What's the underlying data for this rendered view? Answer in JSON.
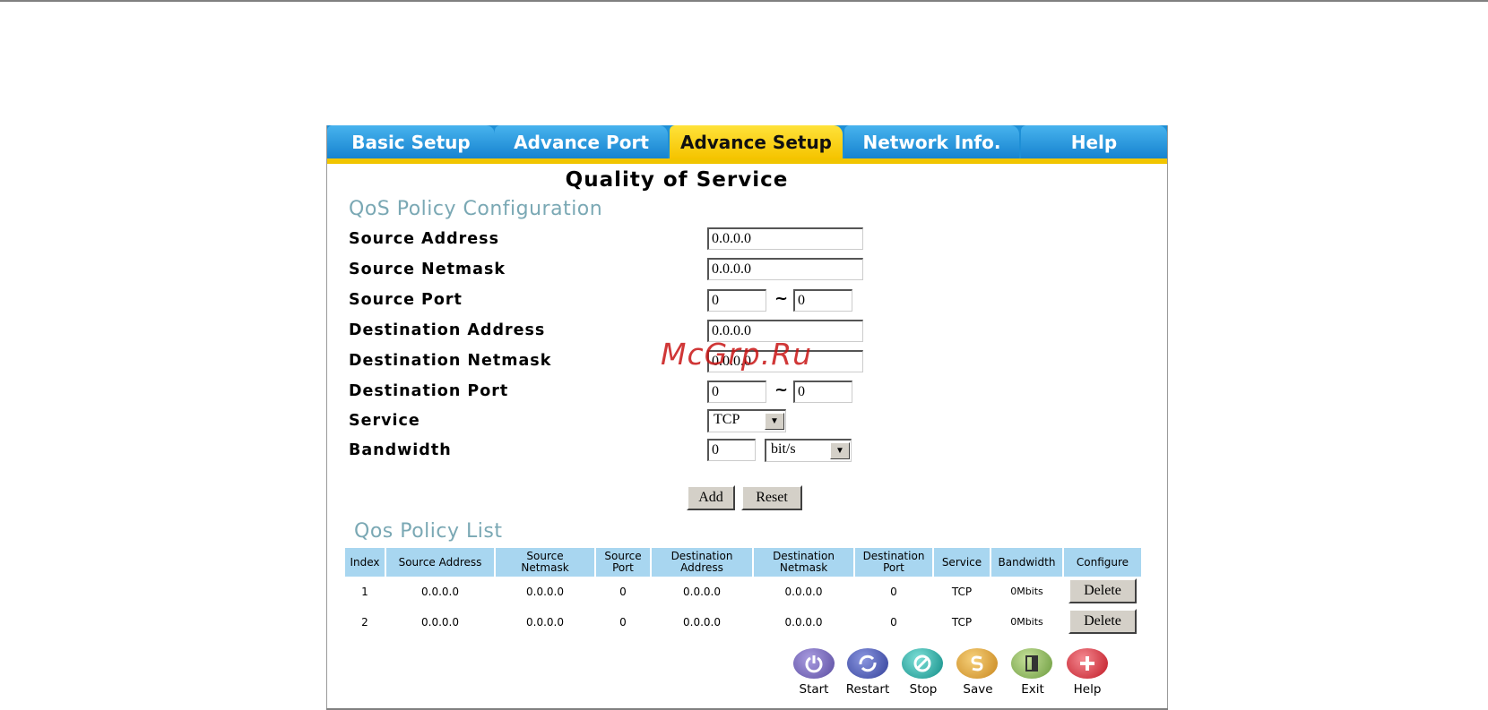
{
  "tabs": [
    {
      "label": "Basic Setup",
      "active": false
    },
    {
      "label": "Advance Port",
      "active": false
    },
    {
      "label": "Advance Setup",
      "active": true
    },
    {
      "label": "Network Info.",
      "active": false
    },
    {
      "label": "Help",
      "active": false
    }
  ],
  "page_title": "Quality of Service",
  "config_heading": "QoS Policy Configuration",
  "fields": {
    "source_address": {
      "label": "Source Address",
      "value": "0.0.0.0"
    },
    "source_netmask": {
      "label": "Source Netmask",
      "value": "0.0.0.0"
    },
    "source_port": {
      "label": "Source Port",
      "from": "0",
      "to": "0"
    },
    "destination_address": {
      "label": "Destination Address",
      "value": "0.0.0.0"
    },
    "destination_netmask": {
      "label": "Destination Netmask",
      "value": "0.0.0.0"
    },
    "destination_port": {
      "label": "Destination Port",
      "from": "0",
      "to": "0"
    },
    "service": {
      "label": "Service",
      "value": "TCP"
    },
    "bandwidth": {
      "label": "Bandwidth",
      "value": "0",
      "unit": "bit/s"
    }
  },
  "range_separator": "~",
  "buttons": {
    "add": "Add",
    "reset": "Reset"
  },
  "list_heading": "Qos Policy List",
  "table": {
    "headers": [
      "Index",
      "Source Address",
      "Source Netmask",
      "Source Port",
      "Destination Address",
      "Destination Netmask",
      "Destination Port",
      "Service",
      "Bandwidth",
      "Configure"
    ],
    "rows": [
      {
        "index": "1",
        "source_address": "0.0.0.0",
        "source_netmask": "0.0.0.0",
        "source_port": "0",
        "destination_address": "0.0.0.0",
        "destination_netmask": "0.0.0.0",
        "destination_port": "0",
        "service": "TCP",
        "bandwidth": "0Mbits",
        "action": "Delete"
      },
      {
        "index": "2",
        "source_address": "0.0.0.0",
        "source_netmask": "0.0.0.0",
        "source_port": "0",
        "destination_address": "0.0.0.0",
        "destination_netmask": "0.0.0.0",
        "destination_port": "0",
        "service": "TCP",
        "bandwidth": "0Mbits",
        "action": "Delete"
      }
    ]
  },
  "toolbar": [
    {
      "label": "Start",
      "icon": "power-icon",
      "color": "#6a5fb0"
    },
    {
      "label": "Restart",
      "icon": "restart-icon",
      "color": "#4a55a8"
    },
    {
      "label": "Stop",
      "icon": "stop-icon",
      "color": "#1aa7a0"
    },
    {
      "label": "Save",
      "icon": "save-icon",
      "color": "#e0a030"
    },
    {
      "label": "Exit",
      "icon": "exit-icon",
      "color": "#7fae50"
    },
    {
      "label": "Help",
      "icon": "help-icon",
      "color": "#d8303a"
    }
  ],
  "watermark": "McGrp.Ru",
  "colors": {
    "tab_blue": "#1e8fd6",
    "tab_active": "#f5c400",
    "heading": "#7aa8b4",
    "table_header": "#a8d6f0"
  }
}
